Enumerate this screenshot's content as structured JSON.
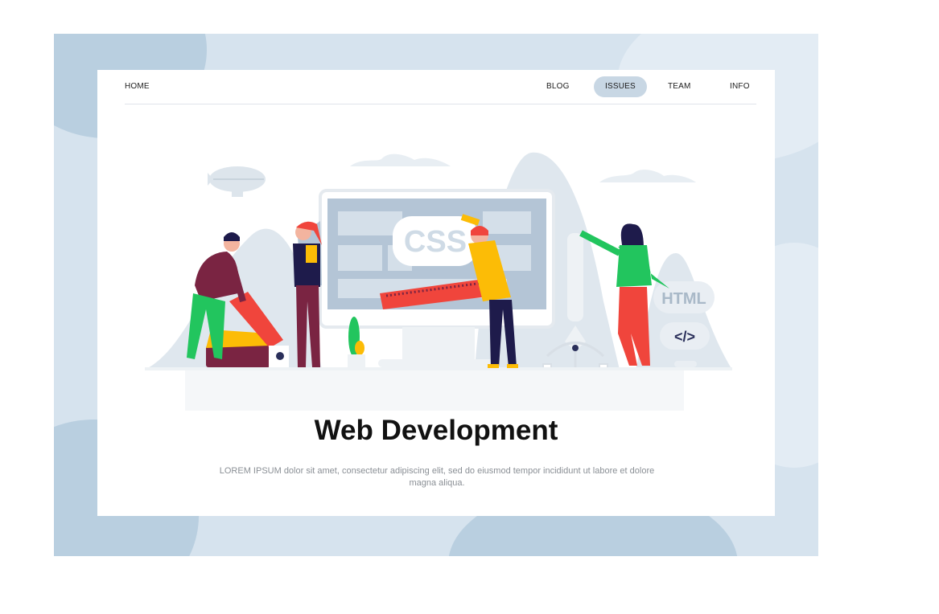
{
  "nav": {
    "home": "HOME",
    "items": [
      {
        "label": "BLOG"
      },
      {
        "label": "ISSUES",
        "active": true
      },
      {
        "label": "TEAM"
      },
      {
        "label": "INFO"
      }
    ]
  },
  "hero": {
    "css_label": "CSS",
    "html_label": "HTML",
    "code_label": "</>"
  },
  "heading": "Web Development",
  "description": "LOREM IPSUM dolor sit amet, consectetur adipiscing elit, sed do eiusmod tempor incididunt ut labore et dolore magna aliqua.",
  "colors": {
    "frame": "#d6e3ee",
    "accent_blue": "#c8d7e4",
    "red": "#f0453c",
    "yellow": "#fcbc06",
    "green": "#22c55e",
    "navy": "#1e1b4b",
    "maroon": "#7a2442"
  }
}
